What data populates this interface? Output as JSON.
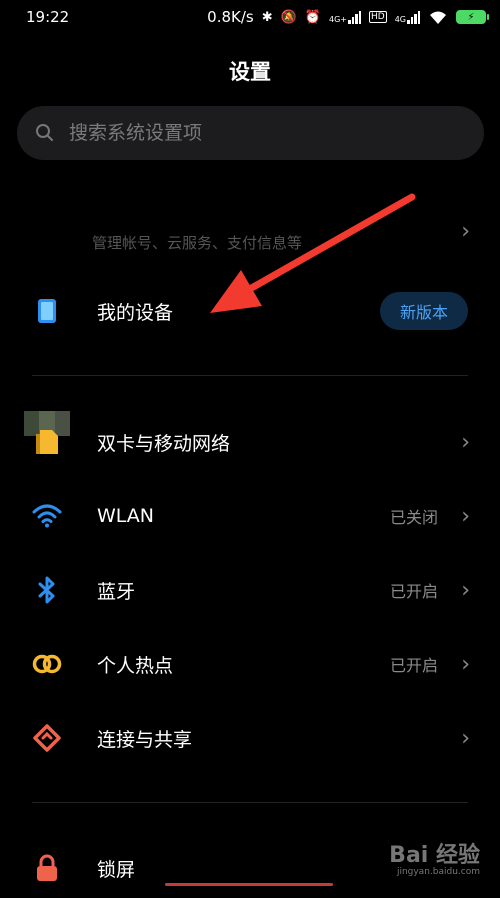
{
  "status_bar": {
    "time": "19:22",
    "net_speed": "0.8K/s",
    "sim1_tag": "4G+",
    "hd_tag": "HD",
    "sim2_tag": "4G",
    "battery_icon": "charging-battery-icon"
  },
  "header": {
    "title": "设置"
  },
  "search": {
    "placeholder": "搜索系统设置项"
  },
  "account": {
    "subtitle": "管理帐号、云服务、支付信息等"
  },
  "my_device": {
    "label": "我的设备",
    "badge": "新版本"
  },
  "connectivity": [
    {
      "id": "dual-sim",
      "label": "双卡与移动网络",
      "value": "",
      "icon": "sim-card-icon",
      "color": "#f5b82e"
    },
    {
      "id": "wlan",
      "label": "WLAN",
      "value": "已关闭",
      "icon": "wifi-icon",
      "color": "#2f8fee"
    },
    {
      "id": "bluetooth",
      "label": "蓝牙",
      "value": "已开启",
      "icon": "bluetooth-icon",
      "color": "#2f8fee"
    },
    {
      "id": "hotspot",
      "label": "个人热点",
      "value": "已开启",
      "icon": "hotspot-icon",
      "color": "#f5b82e"
    },
    {
      "id": "connect-share",
      "label": "连接与共享",
      "value": "",
      "icon": "share-icon",
      "color": "#f0634b"
    }
  ],
  "lock_screen": {
    "label": "锁屏",
    "icon": "lock-icon",
    "color": "#f0634b"
  },
  "watermark": {
    "text": "Bai 经验",
    "sub": "jingyan.baidu.com"
  }
}
